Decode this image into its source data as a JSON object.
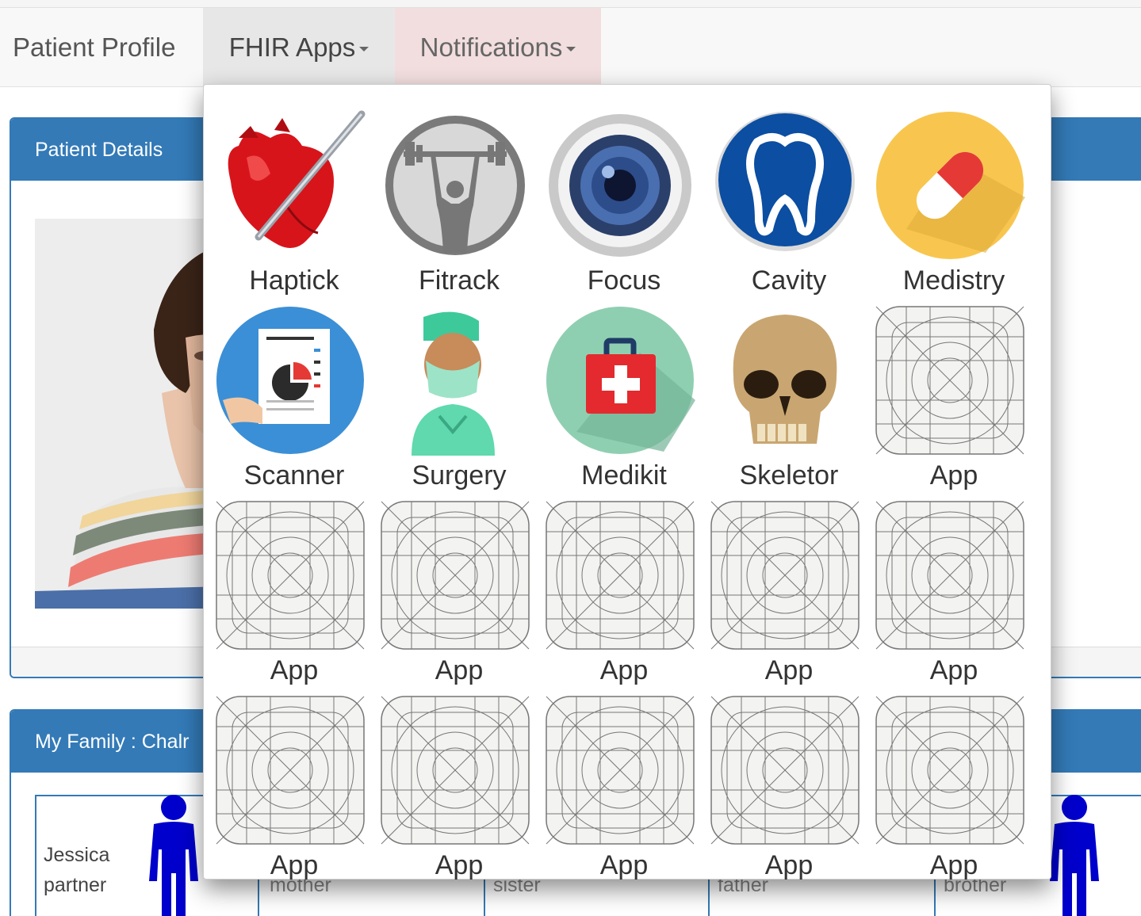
{
  "navbar": {
    "patient_profile": "Patient Profile",
    "fhir_apps": "FHIR Apps",
    "notifications": "Notifications"
  },
  "patient_panel": {
    "title": "Patient Details"
  },
  "family_panel": {
    "title": "My Family : Chalr",
    "members": [
      {
        "name": "Jessica",
        "relation": "partner"
      },
      {
        "name": "",
        "relation": "mother"
      },
      {
        "name": "",
        "relation": "sister"
      },
      {
        "name": "",
        "relation": "father"
      },
      {
        "name": "",
        "relation": "brother"
      }
    ]
  },
  "apps": [
    {
      "label": "Haptick",
      "icon": "heart-scalpel-icon"
    },
    {
      "label": "Fitrack",
      "icon": "weightlifter-icon"
    },
    {
      "label": "Focus",
      "icon": "camera-lens-icon"
    },
    {
      "label": "Cavity",
      "icon": "tooth-icon"
    },
    {
      "label": "Medistry",
      "icon": "pill-capsule-icon"
    },
    {
      "label": "Scanner",
      "icon": "report-scanner-icon"
    },
    {
      "label": "Surgery",
      "icon": "surgeon-icon"
    },
    {
      "label": "Medikit",
      "icon": "first-aid-kit-icon"
    },
    {
      "label": "Skeletor",
      "icon": "skull-icon"
    },
    {
      "label": "App",
      "icon": "app-placeholder-icon"
    },
    {
      "label": "App",
      "icon": "app-placeholder-icon"
    },
    {
      "label": "App",
      "icon": "app-placeholder-icon"
    },
    {
      "label": "App",
      "icon": "app-placeholder-icon"
    },
    {
      "label": "App",
      "icon": "app-placeholder-icon"
    },
    {
      "label": "App",
      "icon": "app-placeholder-icon"
    },
    {
      "label": "App",
      "icon": "app-placeholder-icon"
    },
    {
      "label": "App",
      "icon": "app-placeholder-icon"
    },
    {
      "label": "App",
      "icon": "app-placeholder-icon"
    },
    {
      "label": "App",
      "icon": "app-placeholder-icon"
    },
    {
      "label": "App",
      "icon": "app-placeholder-icon"
    }
  ],
  "colors": {
    "panel_blue": "#337ab7",
    "person_blue": "#0000cc",
    "navbar_bg": "#f8f8f8",
    "notifications_bg": "#f2dede"
  }
}
